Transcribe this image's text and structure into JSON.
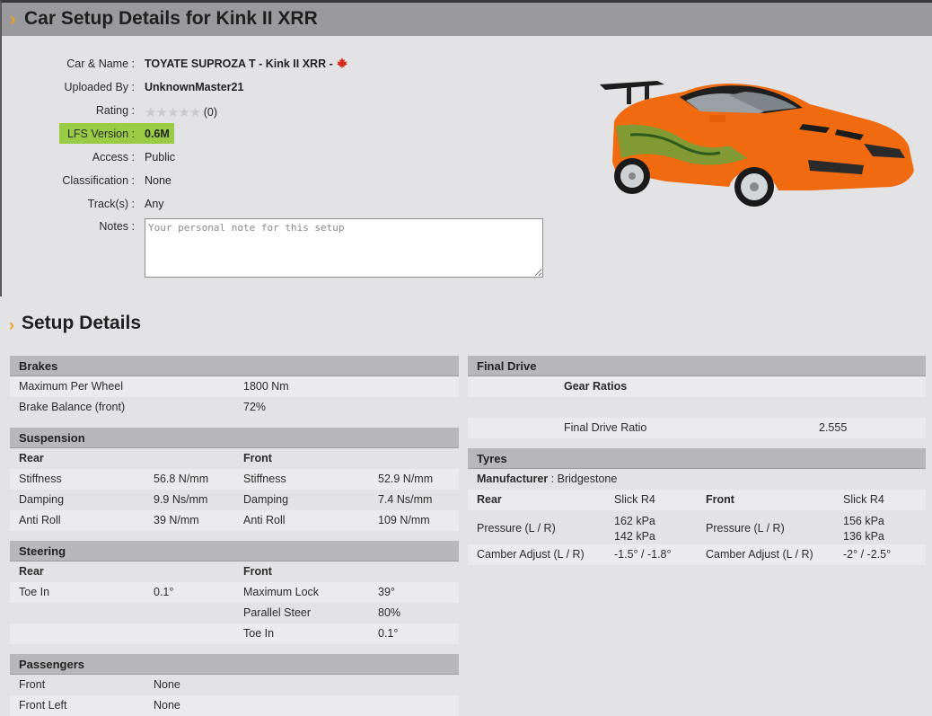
{
  "page": {
    "title": "Car Setup Details for Kink II XRR"
  },
  "info": {
    "car_label": "Car & Name",
    "car_value": "TOYATE SUPROZA T - Kink II XRR -",
    "uploaded_label": "Uploaded By",
    "uploaded_value": "UnknownMaster21",
    "rating_label": "Rating",
    "rating_stars": "★★★★★",
    "rating_count": "(0)",
    "lfs_label": "LFS Version",
    "lfs_value": "0.6M",
    "access_label": "Access",
    "access_value": "Public",
    "class_label": "Classification",
    "class_value": "None",
    "tracks_label": "Track(s)",
    "tracks_value": "Any",
    "notes_label": "Notes",
    "notes_placeholder": "Your personal note for this setup"
  },
  "setup": {
    "title": "Setup Details",
    "brakes": {
      "title": "Brakes",
      "rows": [
        {
          "label": "Maximum Per Wheel",
          "value": "1800 Nm"
        },
        {
          "label": "Brake Balance (front)",
          "value": "72%"
        }
      ]
    },
    "suspension": {
      "title": "Suspension",
      "rear": "Rear",
      "front": "Front",
      "rows": [
        {
          "rl": "Stiffness",
          "rv": "56.8 N/mm",
          "fl": "Stiffness",
          "fv": "52.9 N/mm"
        },
        {
          "rl": "Damping",
          "rv": "9.9 Ns/mm",
          "fl": "Damping",
          "fv": "7.4 Ns/mm"
        },
        {
          "rl": "Anti Roll",
          "rv": "39 N/mm",
          "fl": "Anti Roll",
          "fv": "109 N/mm"
        }
      ]
    },
    "steering": {
      "title": "Steering",
      "rear": "Rear",
      "front": "Front",
      "rear_label": "Toe In",
      "rear_value": "0.1°",
      "front_rows": [
        {
          "label": "Maximum Lock",
          "value": "39°"
        },
        {
          "label": "Parallel Steer",
          "value": "80%"
        },
        {
          "label": "Toe In",
          "value": "0.1°"
        }
      ]
    },
    "passengers": {
      "title": "Passengers",
      "rows": [
        {
          "label": "Front",
          "value": "None"
        },
        {
          "label": "Front Left",
          "value": "None"
        }
      ]
    },
    "final_drive": {
      "title": "Final Drive",
      "gear_ratios": "Gear Ratios",
      "ratio_label": "Final Drive Ratio",
      "ratio_value": "2.555"
    },
    "tyres": {
      "title": "Tyres",
      "manufacturer_label": "Manufacturer",
      "manufacturer_value": "Bridgestone",
      "rear": "Rear",
      "rear_type": "Slick R4",
      "front": "Front",
      "front_type": "Slick R4",
      "pressure_label": "Pressure (L / R)",
      "rear_pressure_l": "162 kPa",
      "rear_pressure_r": "142 kPa",
      "front_pressure_l": "156 kPa",
      "front_pressure_r": "136 kPa",
      "camber_label": "Camber Adjust (L / R)",
      "rear_camber": "-1.5° / -1.8°",
      "front_camber": "-2° / -2.5°"
    }
  },
  "colors": {
    "accent": "#f2a019",
    "highlight": "#99cc44",
    "version_red": "#cc0000",
    "car_orange": "#f06a10"
  }
}
